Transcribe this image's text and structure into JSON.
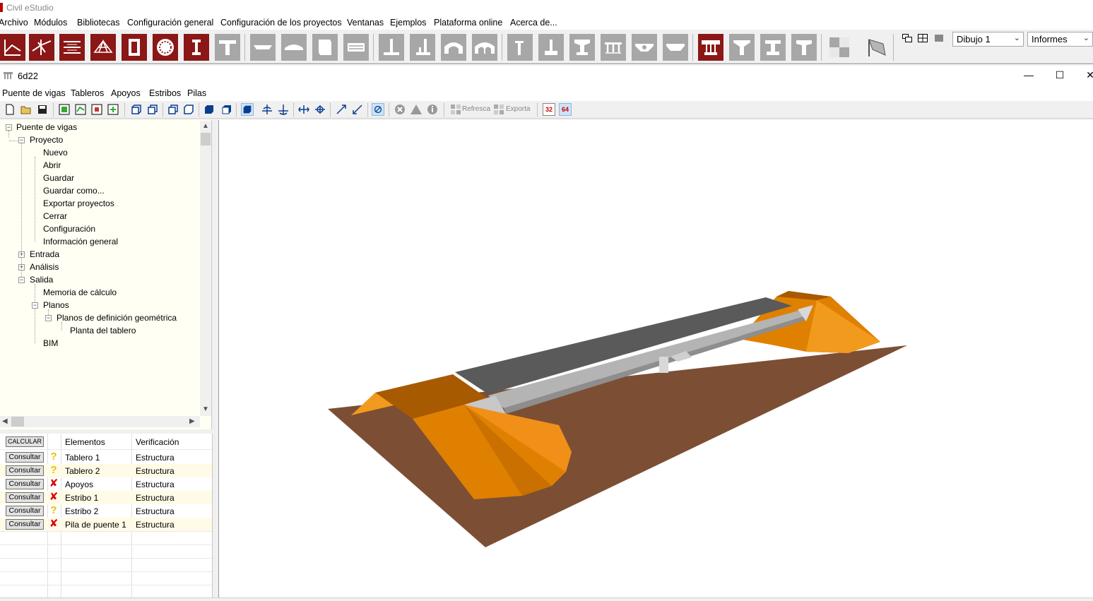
{
  "app": {
    "title": "Civil eStudio",
    "menu": [
      "Archivo",
      "Módulos",
      "Bibliotecas",
      "Configuración general",
      "Configuración de los proyectos",
      "Ventanas",
      "Ejemplos",
      "Plataforma online",
      "Acerca de..."
    ]
  },
  "module_toolbar": {
    "drawing_select": "Dibujo 1",
    "reports_select": "Informes"
  },
  "child_window": {
    "title": "6d22",
    "controls": {
      "minimize": "—",
      "maximize": "☐",
      "close": "✕"
    },
    "menu": [
      "Puente de vigas",
      "Tableros",
      "Apoyos",
      "Estribos",
      "Pilas"
    ],
    "toolbar": {
      "refresh_label": "Refresca",
      "export_label": "Exporta",
      "bits32": "32",
      "bits64": "64"
    }
  },
  "tree": {
    "root": "Puente de vigas",
    "proyecto": "Proyecto",
    "proyecto_items": [
      "Nuevo",
      "Abrir",
      "Guardar",
      "Guardar como...",
      "Exportar proyectos",
      "Cerrar",
      "Configuración",
      "Información general"
    ],
    "entrada": "Entrada",
    "analisis": "Análisis",
    "salida": "Salida",
    "memoria": "Memoria de cálculo",
    "planos": "Planos",
    "planos_def": "Planos de definición geométrica",
    "planta": "Planta del tablero",
    "bim": "BIM"
  },
  "results": {
    "calc_button": "CALCULAR",
    "col_elements": "Elementos",
    "col_verification": "Verificación",
    "consult_label": "Consultar",
    "rows": [
      {
        "element": "Tablero 1",
        "verification": "Estructura",
        "status": "warning"
      },
      {
        "element": "Tablero 2",
        "verification": "Estructura",
        "status": "warning"
      },
      {
        "element": "Apoyos",
        "verification": "Estructura",
        "status": "error"
      },
      {
        "element": "Estribo 1",
        "verification": "Estructura",
        "status": "error"
      },
      {
        "element": "Estribo 2",
        "verification": "Estructura",
        "status": "warning"
      },
      {
        "element": "Pila de puente 1",
        "verification": "Estructura",
        "status": "error"
      }
    ]
  },
  "colors": {
    "module_red": "#8b1717",
    "module_grey": "#a7a7a7",
    "tree_bg": "#fffff4",
    "ground": "#7c4f34",
    "embankment": "#e08000",
    "deck": "#5a5a5a",
    "beam": "#b4b4b4"
  }
}
